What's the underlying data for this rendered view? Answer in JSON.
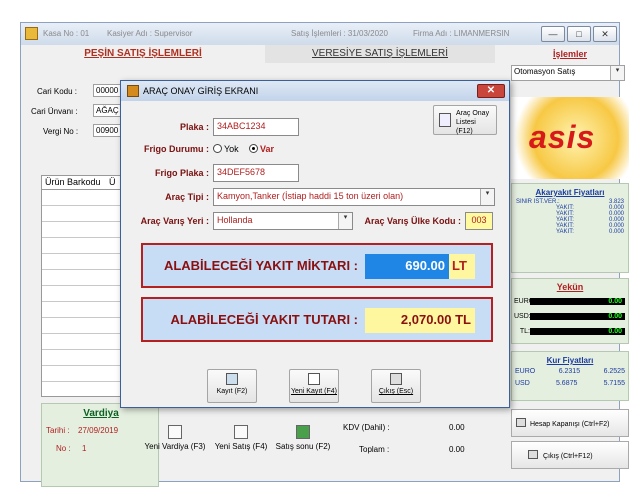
{
  "window": {
    "kasa": "Kasa No : 01",
    "kasiyer": "Kasiyer Adı : Supervisor",
    "satis": "Satış İşlemleri : 31/03/2020",
    "firma": "Firma Adı : LIMANMERSIN",
    "min": "—",
    "max": "□",
    "close": "✕"
  },
  "tabs": {
    "pesin": "PEŞİN SATIŞ İŞLEMLERİ",
    "veresiye": "VERESİYE SATIŞ İŞLEMLERİ"
  },
  "customer": {
    "cari_kodu_label": "Cari Kodu :",
    "cari_kodu": "00000",
    "cari_unvan_label": "Cari Ünvanı :",
    "cari_unvan": "AĞAÇ",
    "vergi_no_label": "Vergi No :",
    "vergi_no": "00900"
  },
  "grid": {
    "col1": "Ürün Barkodu",
    "col2": "Ü"
  },
  "vardiya": {
    "title": "Vardiya",
    "tarih_label": "Tarihi :",
    "tarih": "27/09/2019",
    "no_label": "No :",
    "no": "1"
  },
  "bottom": {
    "yeni_vardiya": "Yeni Vardiya (F3)",
    "yeni_satis": "Yeni Satış (F4)",
    "satis_sonu": "Satış sonu (F2)",
    "kdv_label": "KDV (Dahil) :",
    "kdv": "0.00",
    "toplam_label": "Toplam :",
    "toplam": "0.00"
  },
  "right": {
    "islemler": "İşlemler",
    "otomasyon": "Otomasyon Satış",
    "logo": "asis",
    "akaryakit_title": "Akaryakıt Fiyatları",
    "fuel": [
      {
        "name": "SINIR IST.VER.:",
        "value": "3.823"
      },
      {
        "name": "YAKIT:",
        "value": "0.000"
      },
      {
        "name": "YAKIT:",
        "value": "0.000"
      },
      {
        "name": "YAKIT:",
        "value": "0.000"
      },
      {
        "name": "YAKIT:",
        "value": "0.000"
      },
      {
        "name": "YAKIT:",
        "value": "0.000"
      }
    ],
    "yekun_title": "Yekün",
    "yekun": [
      {
        "name": "EURO:",
        "value": "0.00"
      },
      {
        "name": "USD:",
        "value": "0.00"
      },
      {
        "name": "TL:",
        "value": "0.00"
      }
    ],
    "kur_title": "Kur Fiyatları",
    "kur": [
      {
        "name": "EURO",
        "buy": "6.2315",
        "sell": "6.2525"
      },
      {
        "name": "USD",
        "buy": "5.6875",
        "sell": "5.7155"
      }
    ],
    "hesap_kapanisi": "Hesap Kapanışı (Ctrl+F2)",
    "cikis": "Çıkış (Ctrl+F12)"
  },
  "dialog": {
    "title": "ARAÇ ONAY GİRİŞ EKRANI",
    "close": "✕",
    "liste_btn": "Araç Onay Listesi (F12)",
    "plaka_label": "Plaka :",
    "plaka": "34ABC1234",
    "frigo_durum_label": "Frigo Durumu :",
    "frigo_yok": "Yok",
    "frigo_var": "Var",
    "frigo_plaka_label": "Frigo Plaka :",
    "frigo_plaka": "34DEF5678",
    "arac_tipi_label": "Araç Tipi :",
    "arac_tipi": "Kamyon,Tanker (İstiap haddi 15 ton üzeri olan)",
    "varis_yeri_label": "Araç Varış Yeri :",
    "varis_yeri": "Hollanda",
    "ulke_kodu_label": "Araç Varış Ülke Kodu :",
    "ulke_kodu": "003",
    "miktar_label": "ALABİLECEĞİ YAKIT MİKTARI :",
    "miktar": "690.00",
    "miktar_unit": "LT",
    "tutar_label": "ALABİLECEĞİ YAKIT TUTARI :",
    "tutar": "2,070.00 TL",
    "kayit": "Kayıt (F2)",
    "yeni_kayit": "Yeni Kayıt (F4)",
    "cikis": "Çıkış (Esc)"
  }
}
